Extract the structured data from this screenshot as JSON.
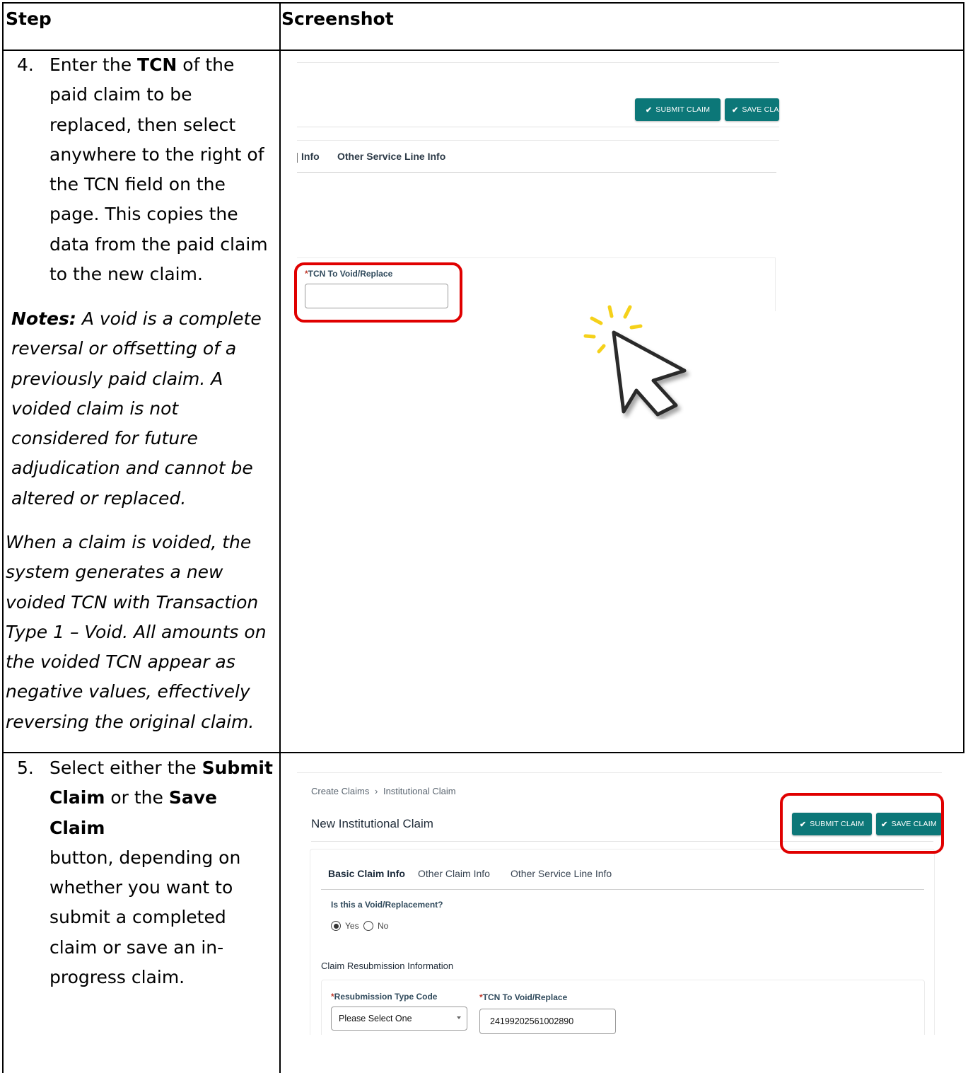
{
  "table": {
    "col_step": "Step",
    "col_screenshot": "Screenshot"
  },
  "step4": {
    "number": "4.",
    "lines": [
      "Enter the ",
      "TCN",
      " of the",
      "paid claim to be",
      "replaced, then select",
      "anywhere to the right of",
      "the TCN field on the",
      "page. This copies the",
      "data from the paid claim",
      "to the new claim."
    ],
    "notes_label": "Notes:",
    "notes_lines": [
      " A void is a complete",
      "reversal or offsetting of a",
      "previously paid claim. A",
      "voided claim is not",
      "considered for future",
      "adjudication and cannot be",
      "altered or replaced."
    ],
    "void_lines": [
      "When a claim is voided, the",
      "system generates a new",
      "voided TCN with Transaction",
      "Type 1 – Void. All amounts on",
      "the voided TCN appear as",
      "negative values, effectively",
      "reversing the original claim."
    ]
  },
  "step5": {
    "number": "5.",
    "lines": [
      "Select either the ",
      "Submit",
      "Claim",
      " or the ",
      "Save Claim",
      "button, depending on",
      "whether you want to",
      "submit a completed",
      "claim or save an in-",
      "progress claim."
    ]
  },
  "shot1": {
    "submit_label": "SUBMIT CLAIM",
    "save_label": "SAVE CLA",
    "tab_partial": "Info",
    "tab_other_service": "Other Service Line Info",
    "tcn_label": "TCN To Void/Replace",
    "tcn_value": ""
  },
  "shot2": {
    "breadcrumb_1": "Create Claims",
    "breadcrumb_sep": "›",
    "breadcrumb_2": "Institutional Claim",
    "title": "New Institutional Claim",
    "submit_label": "SUBMIT CLAIM",
    "save_label": "SAVE CLAIM",
    "tabs": [
      "Basic Claim Info",
      "Other Claim Info",
      "Other Service Line Info"
    ],
    "void_question": "Is this a Void/Replacement?",
    "yes_label": "Yes",
    "no_label": "No",
    "section_title": "Claim Resubmission Information",
    "resub_label": "Resubmission Type Code",
    "resub_value": "Please Select One",
    "tcn_label": "TCN To Void/Replace",
    "tcn_value": "24199202561002890"
  },
  "colors": {
    "button": "#0c7778",
    "highlight": "#e00000",
    "cursor_sparkle": "#f5d11a"
  }
}
